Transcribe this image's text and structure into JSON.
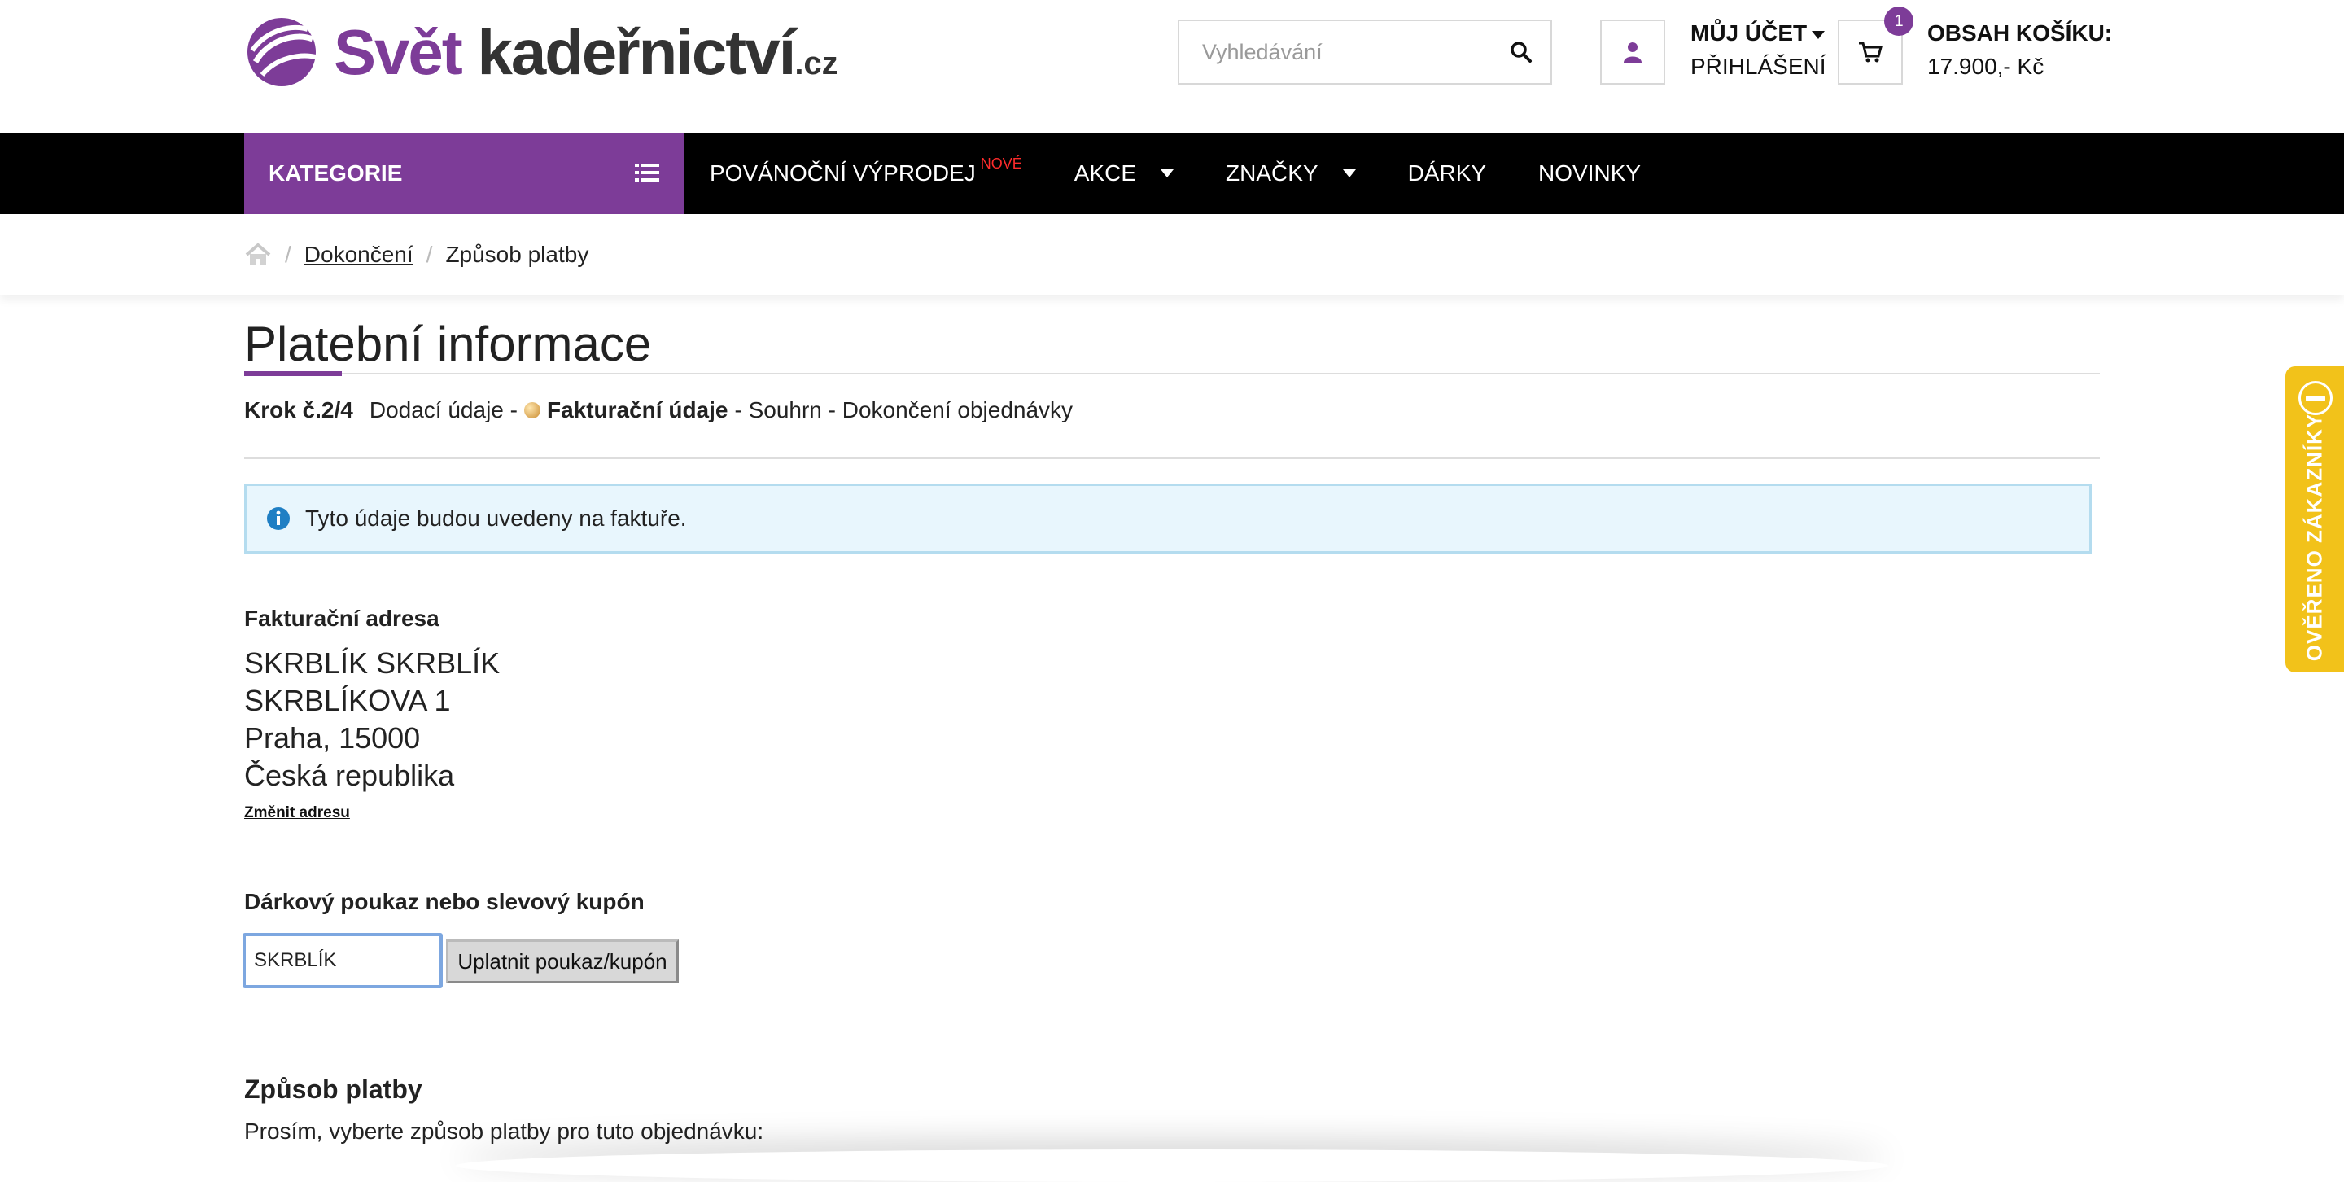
{
  "brand": {
    "name_part1": "Svět",
    "name_part2": "kadeřnictví",
    "tld": ".cz",
    "color": "#7d3c98"
  },
  "search": {
    "placeholder": "Vyhledávání",
    "icon": "search-icon"
  },
  "account": {
    "icon": "user-icon",
    "title": "MŮJ ÚČET",
    "login": "PŘIHLÁŠENÍ"
  },
  "cart": {
    "icon": "cart-icon",
    "count": "1",
    "title": "OBSAH KOŠÍKU:",
    "total": "17.900,- Kč"
  },
  "nav": {
    "categories_label": "KATEGORIE",
    "items": [
      {
        "label": "POVÁNOČNÍ VÝPRODEJ",
        "badge": "NOVÉ"
      },
      {
        "label": "AKCE"
      },
      {
        "label": "ZNAČKY"
      },
      {
        "label": "DÁRKY"
      },
      {
        "label": "NOVINKY"
      }
    ]
  },
  "breadcrumb": {
    "home_icon": "home-icon",
    "items": [
      "Dokončení",
      "Způsob platby"
    ]
  },
  "page": {
    "title": "Platební informace",
    "steps": {
      "label": "Krok č.2/4",
      "s1": "Dodací údaje -",
      "s2": "Fakturační údaje",
      "s3": "- Souhrn - Dokončení objednávky"
    },
    "alert": "Tyto údaje budou uvedeny na faktuře."
  },
  "billing": {
    "heading": "Fakturační adresa",
    "lines": [
      "SKRBLÍK SKRBLÍK",
      "SKRBLÍKOVA 1",
      "Praha, 15000",
      "Česká republika"
    ],
    "change_link": "Změnit adresu"
  },
  "coupon": {
    "heading": "Dárkový poukaz nebo slevový kupón",
    "value": "SKRBLÍK",
    "button": "Uplatnit poukaz/kupón"
  },
  "payment": {
    "heading": "Způsob platby",
    "text": "Prosím, vyberte způsob platby pro tuto objednávku:"
  },
  "side_badge": {
    "label": "OVĚŘENO ZÁKAZNÍKY",
    "color": "#f2c21a"
  }
}
